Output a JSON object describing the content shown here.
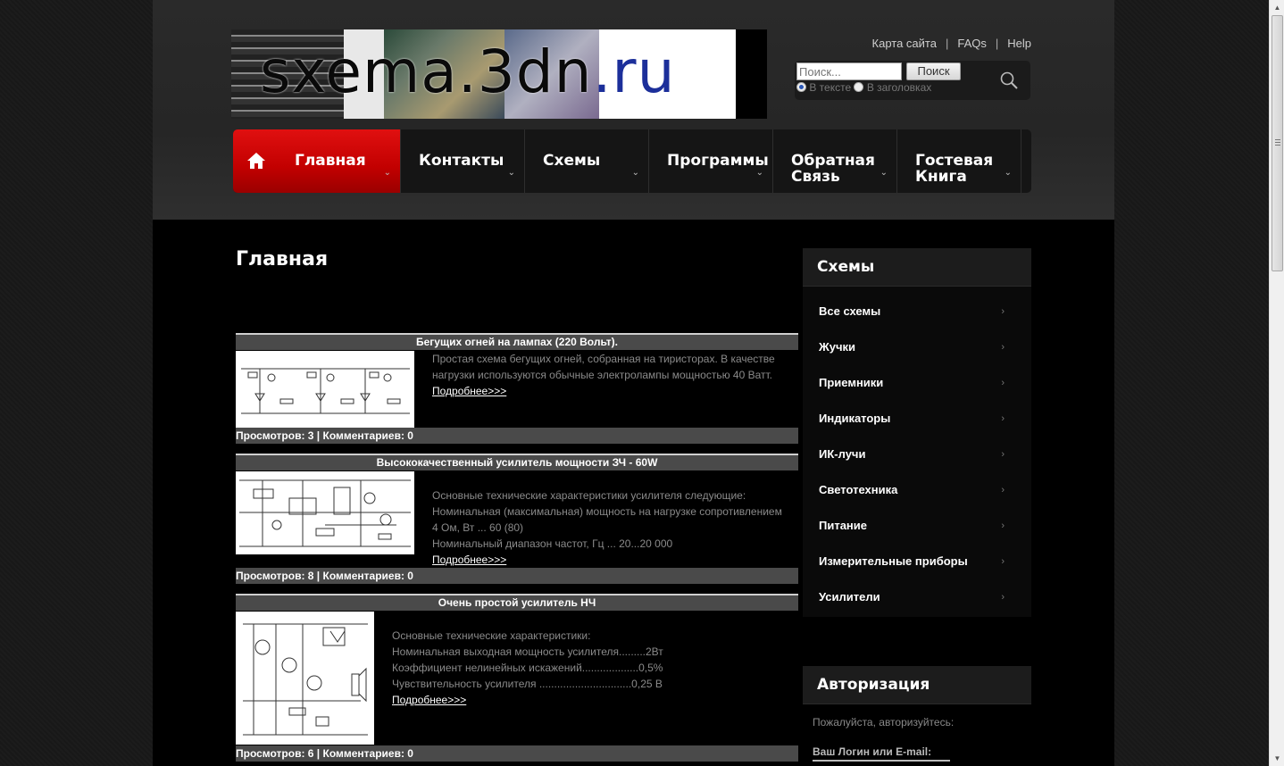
{
  "logo": {
    "text_main": "sxema.3dn",
    "text_tld": ".ru"
  },
  "top_links": [
    "Карта сайта",
    "FAQs",
    "Help"
  ],
  "search": {
    "placeholder": "Поиск...",
    "button": "Поиск",
    "radio_text": "В тексте",
    "radio_titles": "В заголовках",
    "selected": "В тексте"
  },
  "nav": [
    {
      "label": "Главная",
      "active": true
    },
    {
      "label": "Контакты"
    },
    {
      "label": "Схемы"
    },
    {
      "label": "Программы"
    },
    {
      "label": "Обратная Связь",
      "line1": "Обратная",
      "line2": "Связь"
    },
    {
      "label": "Гостевая Книга",
      "line1": "Гостевая",
      "line2": "Книга"
    }
  ],
  "page_title": "Главная",
  "entries": [
    {
      "title": "Бегущих огней на лампах (220 Вольт).",
      "desc": [
        "Простая схема бегущих огней, собранная на тиристорах. В качестве",
        "нагрузки используются обычные электролампы мощностью 40 Ватт."
      ],
      "more": "Подробнее>>>",
      "stats": "Просмотров: 3 | Комментариев: 0"
    },
    {
      "title": "Высококачественный усилитель мощности ЗЧ - 60W",
      "desc": [
        "Основные технические характеристики усилителя следующие:",
        "Номинальная (максимальная) мощность на нагрузке сопротивлением",
        "4 Ом, Вт ... 60 (80)",
        "Номинальный диапазон частот, Гц ... 20...20 000"
      ],
      "more": "Подробнее>>>",
      "stats": "Просмотров: 8 | Комментариев: 0"
    },
    {
      "title": "Очень простой усилитель НЧ",
      "desc": [
        "Основные технические характеристики:",
        "Номинальная выходная мощность усилителя.........2Вт",
        "Коэффициент нелинейных искажений...................0,5%",
        "Чувствительность усилителя ...............................0,25 В"
      ],
      "more": "Подробнее>>>",
      "stats": "Просмотров: 6 | Комментариев: 0"
    }
  ],
  "sidebar": {
    "schemes_title": "Схемы",
    "schemes": [
      "Все схемы",
      "Жучки",
      "Приемники",
      "Индикаторы",
      "ИК-лучи",
      "Светотехника",
      "Питание",
      "Измерительные приборы",
      "Усилители"
    ],
    "auth_title": "Авторизация",
    "auth_hint": "Пожалуйста, авторизуйтесь:",
    "login_label": "Ваш Логин или E-mail:"
  },
  "colors": {
    "accent": "#c20000",
    "background": "#000000",
    "header": "#262626"
  }
}
